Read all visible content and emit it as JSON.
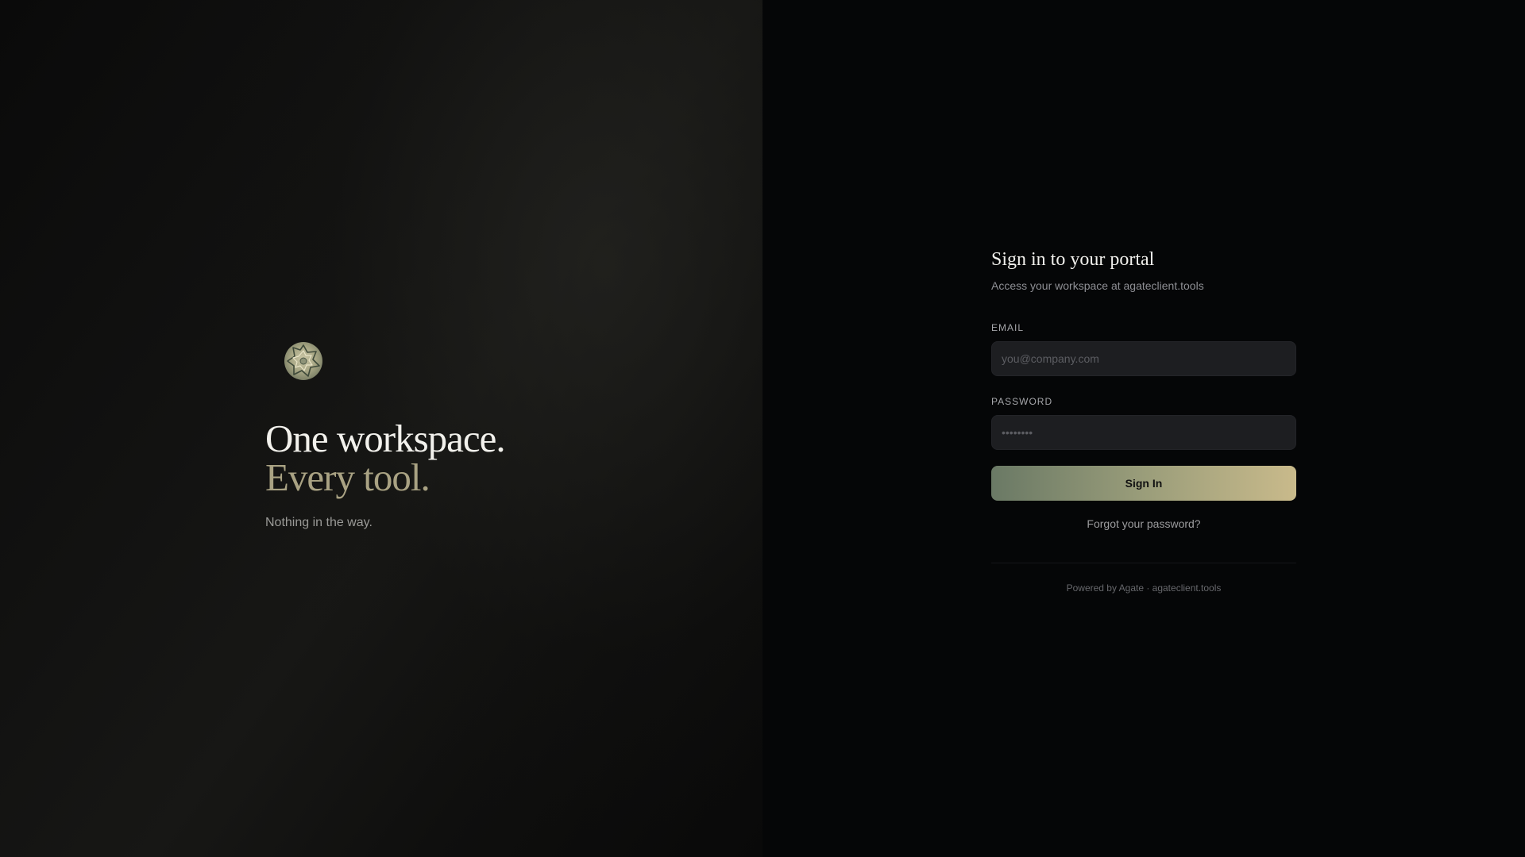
{
  "hero": {
    "logo_icon": "agate-stone-icon",
    "headline_line1": "One workspace.",
    "headline_line2": "Every tool.",
    "tagline": "Nothing in the way."
  },
  "signin": {
    "title": "Sign in to your portal",
    "subtitle": "Access your workspace at agateclient.tools",
    "email_label": "EMAIL",
    "email_placeholder": "you@company.com",
    "email_value": "",
    "password_label": "PASSWORD",
    "password_placeholder": "••••••••",
    "password_value": "",
    "submit_label": "Sign In",
    "forgot_label": "Forgot your password?",
    "footer": "Powered by Agate · agateclient.tools"
  },
  "colors": {
    "accent_start": "#6a7965",
    "accent_end": "#c9ba8b",
    "headline_accent": "#a9a283"
  }
}
